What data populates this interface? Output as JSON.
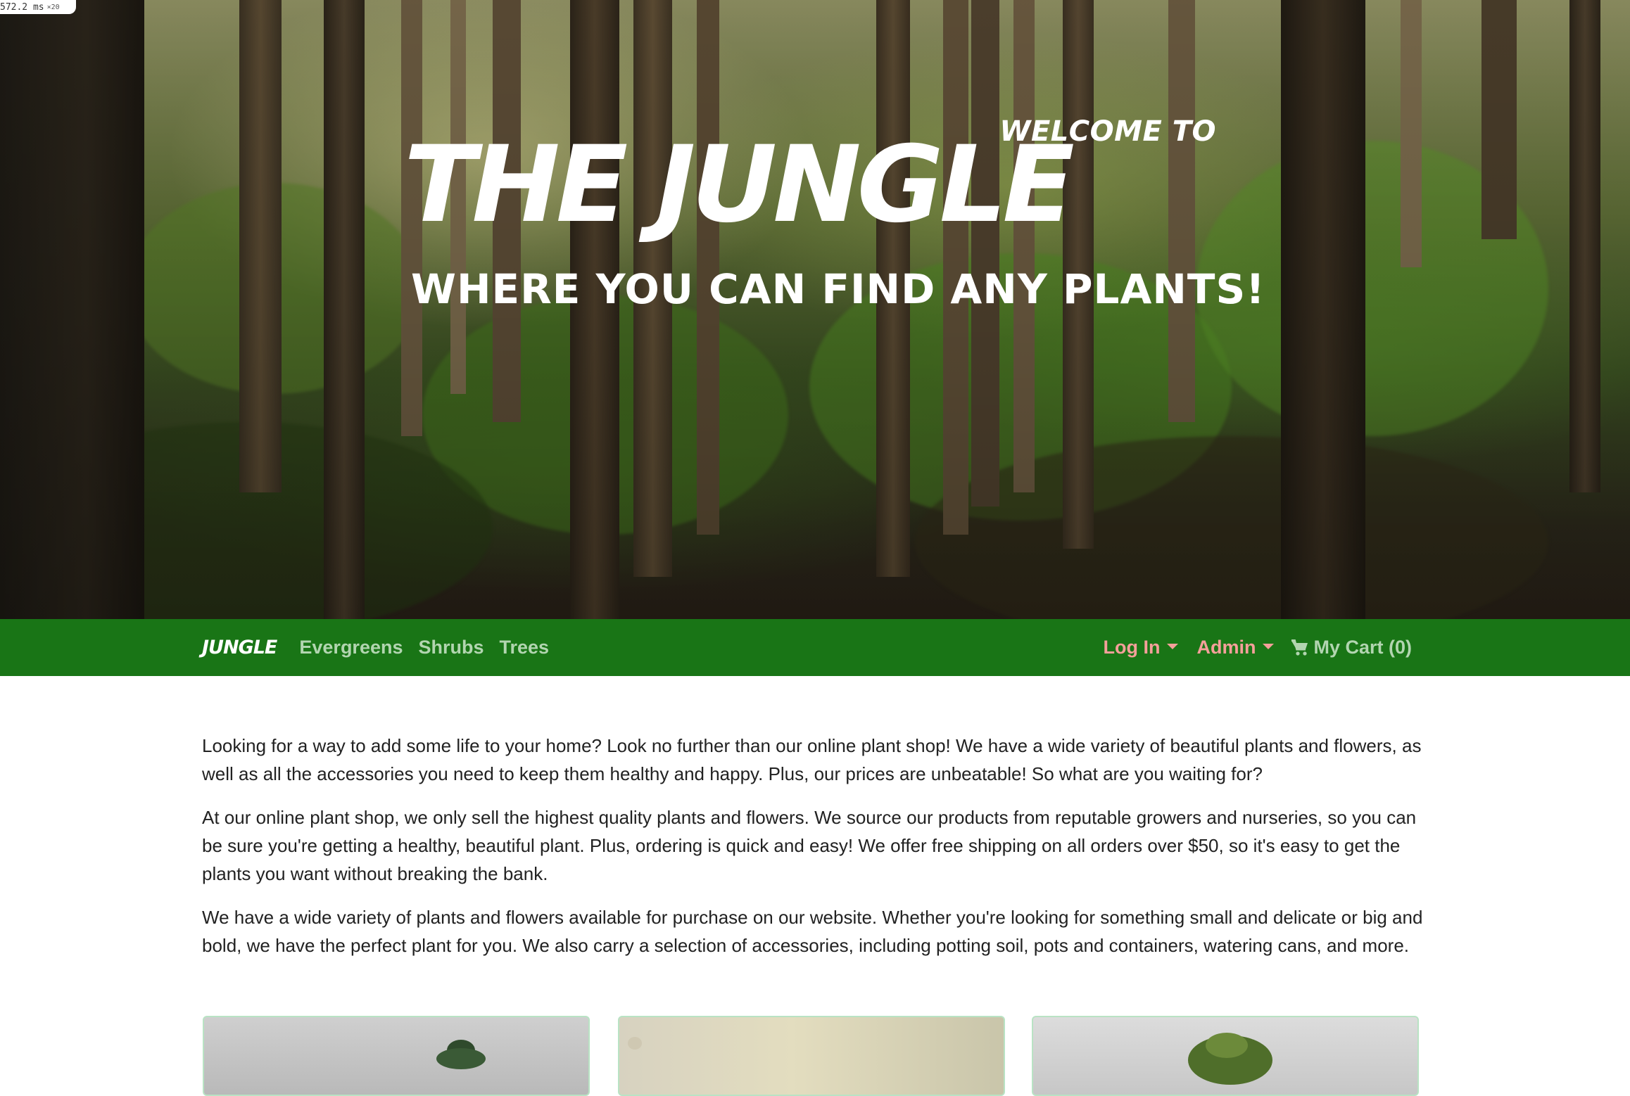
{
  "perf_badge": {
    "value": "572.2 ms",
    "multiplier": "×20"
  },
  "hero": {
    "welcome": "WELCOME TO",
    "title": "THE JUNGLE",
    "tagline": "WHERE YOU CAN FIND ANY PLANTS!"
  },
  "nav": {
    "brand": "JUNGLE",
    "links": [
      "Evergreens",
      "Shrubs",
      "Trees"
    ],
    "login": "Log In",
    "admin": "Admin",
    "cart": "My Cart (0)",
    "colors": {
      "bar": "#197516",
      "link": "#b2d5b0",
      "accent": "#f5a09a"
    }
  },
  "content": {
    "paragraphs": [
      "Looking for a way to add some life to your home? Look no further than our online plant shop! We have a wide variety of beautiful plants and flowers, as well as all the accessories you need to keep them healthy and happy. Plus, our prices are unbeatable! So what are you waiting for?",
      "At our online plant shop, we only sell the highest quality plants and flowers. We source our products from reputable growers and nurseries, so you can be sure you're getting a healthy, beautiful plant. Plus, ordering is quick and easy! We offer free shipping on all orders over $50, so it's easy to get the plants you want without breaking the bank.",
      "We have a wide variety of plants and flowers available for purchase on our website. Whether you're looking for something small and delicate or big and bold, we have the perfect plant for you. We also carry a selection of accessories, including potting soil, pots and containers, watering cans, and more."
    ]
  },
  "products": {
    "cards": [
      {
        "icon": "product-image-evergreen"
      },
      {
        "icon": "product-image-plant"
      },
      {
        "icon": "product-image-bonsai"
      }
    ]
  }
}
